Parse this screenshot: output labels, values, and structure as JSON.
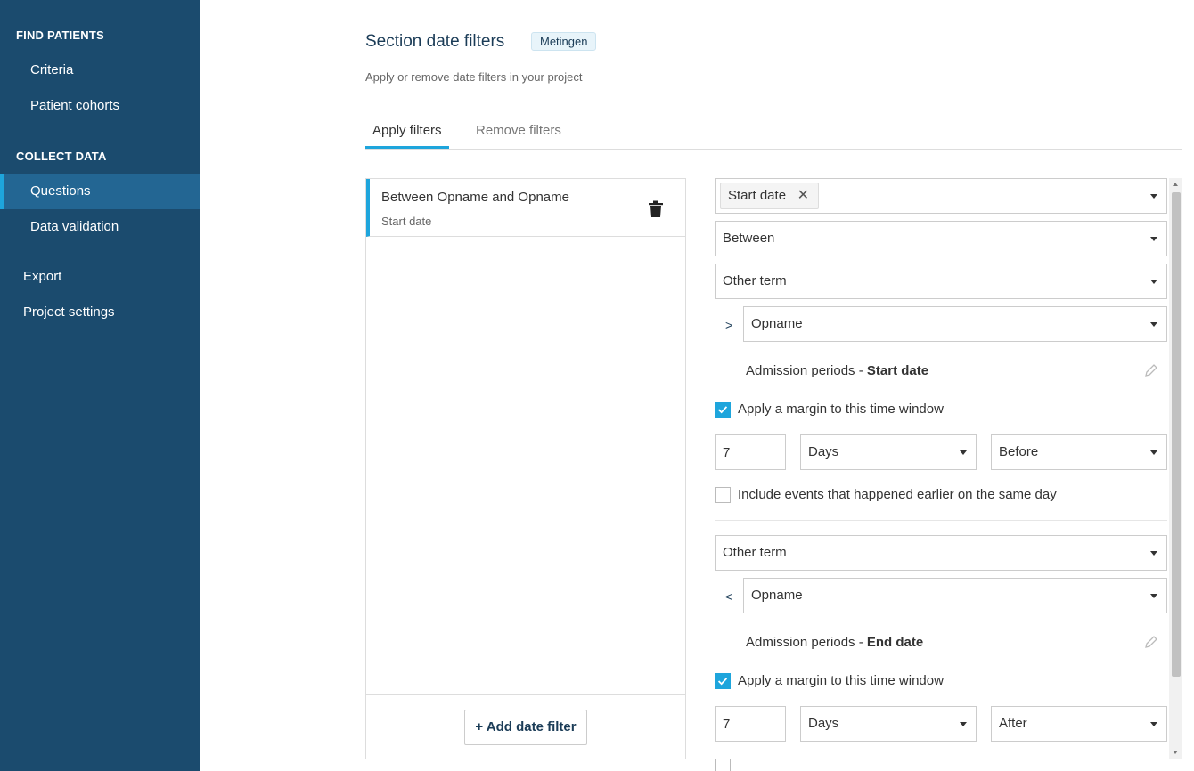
{
  "sidebar": {
    "find_patients_heading": "FIND PATIENTS",
    "criteria": "Criteria",
    "patient_cohorts": "Patient cohorts",
    "collect_data_heading": "COLLECT DATA",
    "questions": "Questions",
    "data_validation": "Data validation",
    "export": "Export",
    "project_settings": "Project settings",
    "active_item": "Questions"
  },
  "header": {
    "title": "Section date filters",
    "badge": "Metingen",
    "subtitle": "Apply or remove date filters in your project"
  },
  "tabs": [
    {
      "label": "Apply filters",
      "active": true
    },
    {
      "label": "Remove filters",
      "active": false
    }
  ],
  "filter_list": {
    "items": [
      {
        "title": "Between Opname and Opname",
        "subtitle": "Start date"
      }
    ],
    "add_button": "+ Add date filter"
  },
  "form": {
    "date_tag": "Start date",
    "operator": "Between",
    "lower": {
      "term_type": "Other term",
      "comparator": ">",
      "term": "Opname",
      "info_prefix": "Admission periods - ",
      "info_field": "Start date",
      "margin_checked": true,
      "margin_label": "Apply a margin to this time window",
      "margin_value": "7",
      "unit": "Days",
      "direction": "Before",
      "same_day_checked": false,
      "same_day_label": "Include events that happened earlier on the same day"
    },
    "upper": {
      "term_type": "Other term",
      "comparator": "<",
      "term": "Opname",
      "info_prefix": "Admission periods - ",
      "info_field": "End date",
      "margin_checked": true,
      "margin_label": "Apply a margin to this time window",
      "margin_value": "7",
      "unit": "Days",
      "direction": "After"
    }
  },
  "colors": {
    "sidebar_bg": "#1b4b6e",
    "sidebar_active": "#236693",
    "accent": "#1ea5dc"
  }
}
